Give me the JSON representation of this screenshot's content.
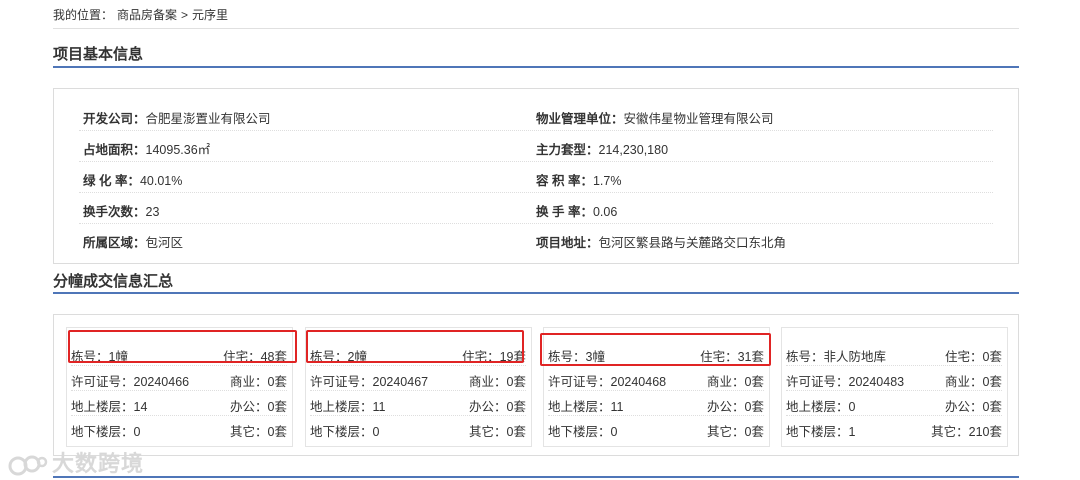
{
  "breadcrumb": {
    "prefix": "我的位置：",
    "item1": "商品房备案",
    "separator": ">",
    "item2": "元序里"
  },
  "project_section": {
    "title": "项目基本信息",
    "rows": [
      {
        "left_label": "开发公司：",
        "left_value": "合肥星澎置业有限公司",
        "right_label": "物业管理单位：",
        "right_value": "安徽伟星物业管理有限公司"
      },
      {
        "left_label": "占地面积：",
        "left_value": "14095.36㎡",
        "right_label": "主力套型：",
        "right_value": "214,230,180"
      },
      {
        "left_label": "绿 化 率：",
        "left_value": "40.01%",
        "right_label": "容 积 率：",
        "right_value": "1.7%"
      },
      {
        "left_label": "换手次数：",
        "left_value": "23",
        "right_label": "换 手 率：",
        "right_value": "0.06"
      },
      {
        "left_label": "所属区域：",
        "left_value": "包河区",
        "right_label": "项目地址：",
        "right_value": "包河区繁县路与关麓路交口东北角"
      }
    ]
  },
  "buildings_section": {
    "title": "分幢成交信息汇总",
    "cards": [
      {
        "building": "栋号：1幢",
        "residential": "住宅：48套",
        "permit": "许可证号：20240466",
        "commercial": "商业：0套",
        "above_floors": "地上楼层：14",
        "office": "办公：0套",
        "below_floors": "地下楼层：0",
        "other": "其它：0套",
        "highlighted": true
      },
      {
        "building": "栋号：2幢",
        "residential": "住宅：19套",
        "permit": "许可证号：20240467",
        "commercial": "商业：0套",
        "above_floors": "地上楼层：11",
        "office": "办公：0套",
        "below_floors": "地下楼层：0",
        "other": "其它：0套",
        "highlighted": true
      },
      {
        "building": "栋号：3幢",
        "residential": "住宅：31套",
        "permit": "许可证号：20240468",
        "commercial": "商业：0套",
        "above_floors": "地上楼层：11",
        "office": "办公：0套",
        "below_floors": "地下楼层：0",
        "other": "其它：0套",
        "highlighted": true
      },
      {
        "building": "栋号：非人防地库",
        "residential": "住宅：0套",
        "permit": "许可证号：20240483",
        "commercial": "商业：0套",
        "above_floors": "地上楼层：0",
        "office": "办公：0套",
        "below_floors": "地下楼层：1",
        "other": "其它：210套",
        "highlighted": false
      }
    ]
  },
  "watermark": {
    "text": "大数跨境",
    "logo_icon": "watermark-logo-icon"
  },
  "colors": {
    "section_rule": "#4f76b8",
    "highlight": "#e02424",
    "border": "#dcdcdc"
  }
}
